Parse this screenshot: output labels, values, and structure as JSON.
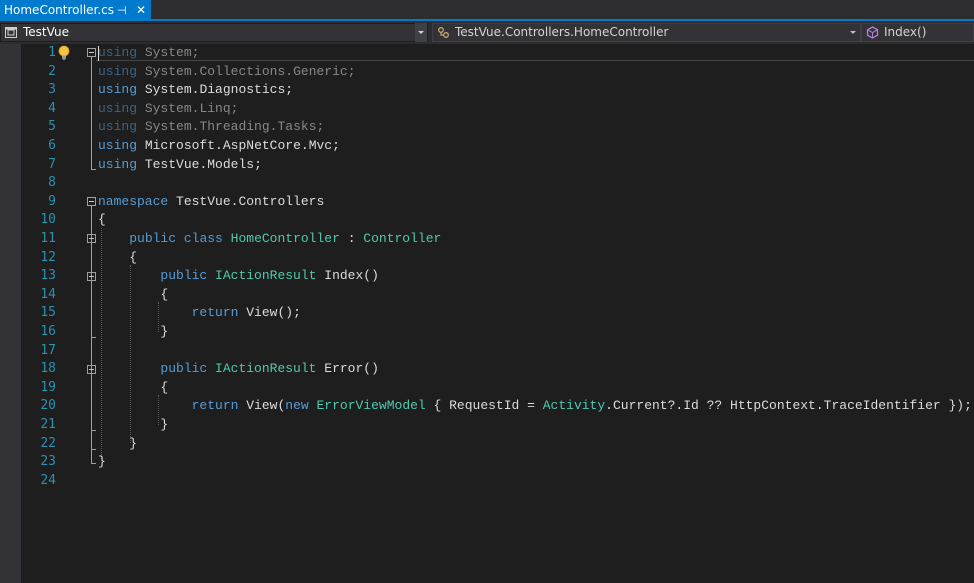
{
  "tab": {
    "title": "HomeController.cs",
    "pin_glyph": "⊣",
    "close_glyph": "✕"
  },
  "navbar": {
    "project": "TestVue",
    "class": "TestVue.Controllers.HomeController",
    "member": "Index()"
  },
  "editor": {
    "line_numbers": [
      "1",
      "2",
      "3",
      "4",
      "5",
      "6",
      "7",
      "8",
      "9",
      "10",
      "11",
      "12",
      "13",
      "14",
      "15",
      "16",
      "17",
      "18",
      "19",
      "20",
      "21",
      "22",
      "23",
      "24"
    ],
    "lines": [
      "using System;",
      "using System.Collections.Generic;",
      "using System.Diagnostics;",
      "using System.Linq;",
      "using System.Threading.Tasks;",
      "using Microsoft.AspNetCore.Mvc;",
      "using TestVue.Models;",
      "",
      "namespace TestVue.Controllers",
      "{",
      "    public class HomeController : Controller",
      "    {",
      "        public IActionResult Index()",
      "        {",
      "            return View();",
      "        }",
      "",
      "        public IActionResult Error()",
      "        {",
      "            return View(new ErrorViewModel { RequestId = Activity.Current?.Id ?? HttpContext.TraceIdentifier });",
      "        }",
      "    }",
      "}",
      ""
    ]
  },
  "colors": {
    "keyword": "#569cd6",
    "type": "#4ec9b0",
    "line_number": "#2b91af",
    "accent": "#007acc",
    "text": "#dcdcdc"
  }
}
